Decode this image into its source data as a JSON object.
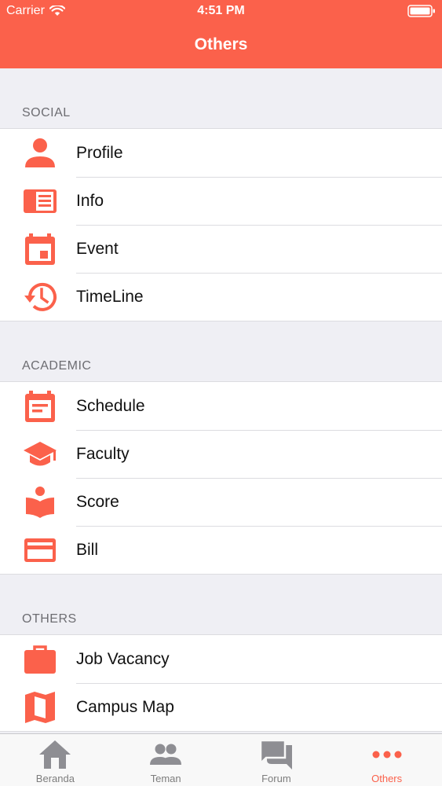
{
  "status_bar": {
    "carrier": "Carrier",
    "time": "4:51 PM"
  },
  "nav": {
    "title": "Others"
  },
  "colors": {
    "accent": "#fb614b",
    "tab_inactive": "#8e8e93"
  },
  "sections": [
    {
      "title": "SOCIAL",
      "items": [
        {
          "label": "Profile",
          "icon": "person-icon"
        },
        {
          "label": "Info",
          "icon": "info-icon"
        },
        {
          "label": "Event",
          "icon": "calendar-event-icon"
        },
        {
          "label": "TimeLine",
          "icon": "history-icon"
        }
      ]
    },
    {
      "title": "ACADEMIC",
      "items": [
        {
          "label": "Schedule",
          "icon": "schedule-icon"
        },
        {
          "label": "Faculty",
          "icon": "graduation-cap-icon"
        },
        {
          "label": "Score",
          "icon": "reading-icon"
        },
        {
          "label": "Bill",
          "icon": "credit-card-icon"
        }
      ]
    },
    {
      "title": "OTHERS",
      "items": [
        {
          "label": "Job Vacancy",
          "icon": "briefcase-icon"
        },
        {
          "label": "Campus Map",
          "icon": "map-icon"
        }
      ]
    }
  ],
  "tabs": [
    {
      "label": "Beranda",
      "icon": "home-icon",
      "active": false
    },
    {
      "label": "Teman",
      "icon": "people-icon",
      "active": false
    },
    {
      "label": "Forum",
      "icon": "forum-icon",
      "active": false
    },
    {
      "label": "Others",
      "icon": "more-icon",
      "active": true
    }
  ]
}
